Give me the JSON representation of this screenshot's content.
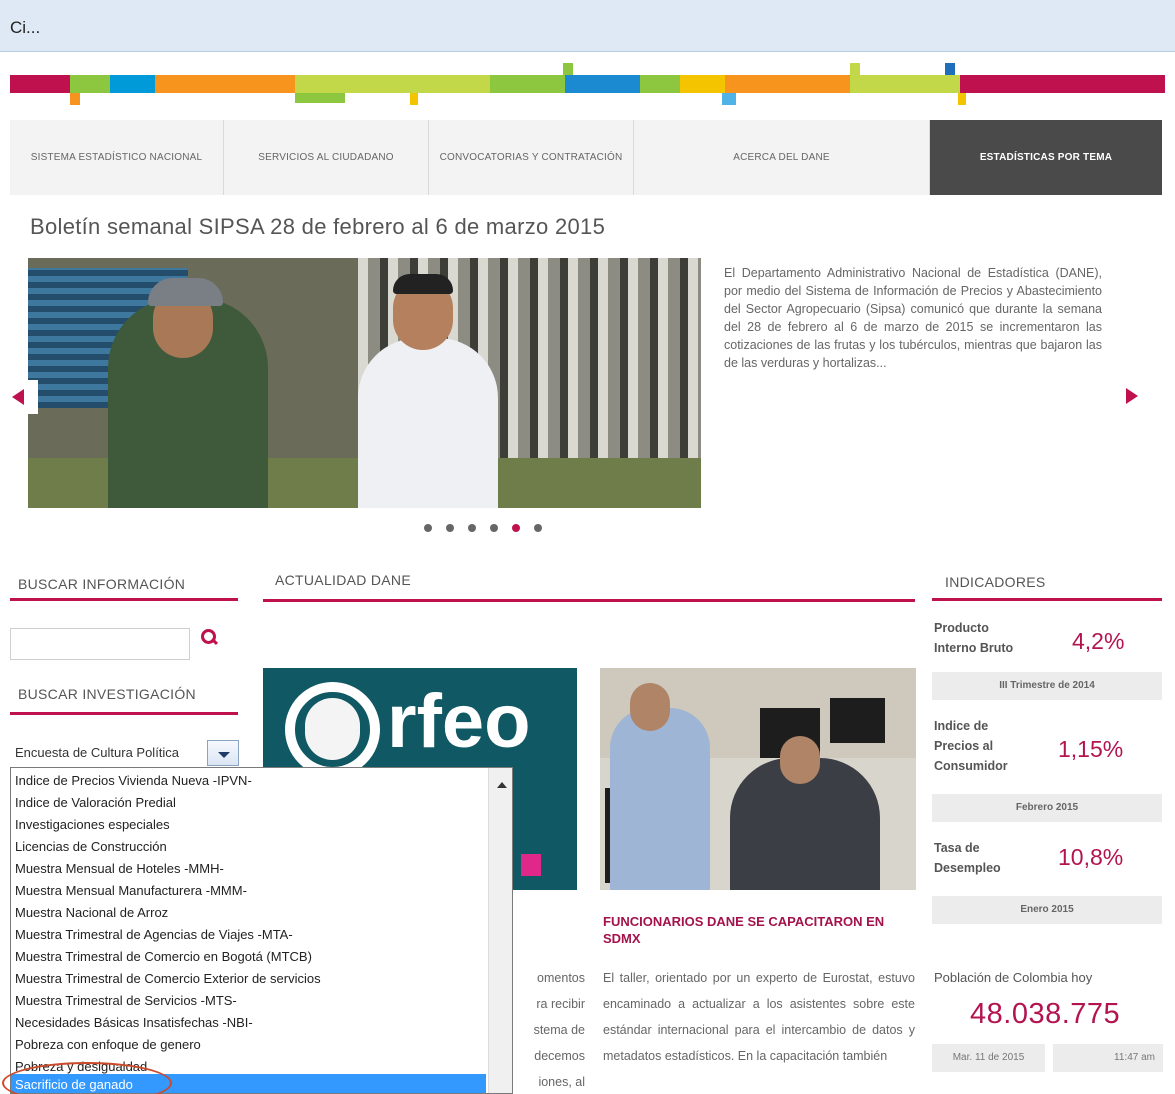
{
  "window": {
    "title": "Ci..."
  },
  "brand_colors": {
    "accent": "#c0114f",
    "magenta": "#b31450",
    "green": "#8dc63f",
    "blue": "#009ad9",
    "orange": "#f7941d",
    "yellow": "#f5c400"
  },
  "nav": {
    "items": [
      {
        "label": "SISTEMA ESTADÍSTICO NACIONAL"
      },
      {
        "label": "SERVICIOS AL CIUDADANO"
      },
      {
        "label": "CONVOCATORIAS Y CONTRATACIÓN"
      },
      {
        "label": "ACERCA DEL DANE"
      },
      {
        "label": "ESTADÍSTICAS POR TEMA"
      }
    ],
    "active_index": 4
  },
  "hero": {
    "headline": "Boletín semanal SIPSA 28 de febrero al 6 de marzo 2015",
    "text": "El Departamento Administrativo Nacional de Estadística (DANE), por medio del Sistema de Información de Precios y Abastecimiento del Sector Agropecuario (Sipsa) comunicó que durante la semana del 28 de febrero al 6 de marzo de 2015 se incrementaron las cotizaciones de las frutas y los tubérculos, mientras que bajaron las de las verduras y hortalizas...",
    "slide_count": 6,
    "active_slide": 5
  },
  "search": {
    "title": "BUSCAR INFORMACIÓN",
    "input_value": "",
    "research_title": "BUSCAR INVESTIGACIÓN",
    "selected_value": "Encuesta de Cultura Política",
    "options": [
      "Indice de Precios Vivienda Nueva -IPVN-",
      "Indice de Valoración Predial",
      "Investigaciones especiales",
      "Licencias de Construcción",
      "Muestra Mensual de Hoteles -MMH-",
      "Muestra Mensual Manufacturera -MMM-",
      "Muestra Nacional de Arroz",
      "Muestra Trimestral de Agencias de Viajes -MTA-",
      "Muestra Trimestral de Comercio en Bogotá (MTCB)",
      "Muestra Trimestral de Comercio Exterior de servicios",
      "Muestra Trimestral de Servicios -MTS-",
      "Necesidades Básicas Insatisfechas -NBI-",
      "Pobreza con enfoque de genero",
      "Pobreza y desigualdad",
      "Sacrificio de ganado"
    ],
    "highlighted_option": "Sacrificio de ganado"
  },
  "news": {
    "title": "ACTUALIDAD DANE",
    "card1": {
      "logo_text": "rfeo",
      "partial_lines": [
        "omentos",
        "ra recibir",
        "stema de",
        "decemos",
        "iones, al"
      ]
    },
    "card2": {
      "title": "FUNCIONARIOS DANE SE CAPACITARON EN SDMX",
      "text": "El taller, orientado por un experto de Eurostat, estuvo encaminado a actualizar a los asistentes sobre este estándar internacional para el intercambio de datos y metadatos estadísticos. En la capacitación también"
    }
  },
  "indicators": {
    "title": "INDICADORES",
    "items": [
      {
        "name_line1": "Producto",
        "name_line2": "Interno Bruto",
        "name_line3": "",
        "value": "4,2%",
        "period": "III Trimestre de 2014"
      },
      {
        "name_line1": "Indice de",
        "name_line2": "Precios al",
        "name_line3": "Consumidor",
        "value": "1,15%",
        "period": "Febrero 2015"
      },
      {
        "name_line1": "Tasa de",
        "name_line2": "Desempleo",
        "name_line3": "",
        "value": "10,8%",
        "period": "Enero 2015"
      }
    ],
    "population": {
      "label": "Población de Colombia hoy",
      "value": "48.038.775",
      "date": "Mar. 11 de 2015",
      "time": "11:47 am"
    }
  }
}
